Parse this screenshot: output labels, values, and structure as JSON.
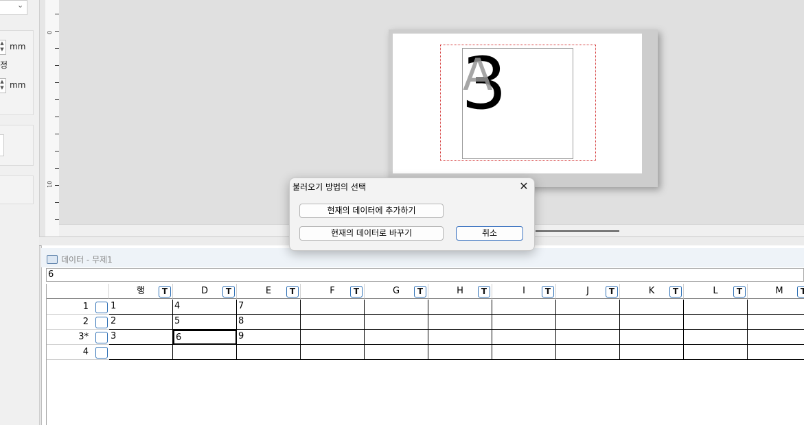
{
  "left_panel": {
    "unit_mm_1": "mm",
    "partial_label": "정",
    "unit_mm_2": "mm",
    "spin_up": "▲",
    "spin_down": "▼",
    "combo_arrow": "⌄"
  },
  "ruler": {
    "labels": [
      "0",
      "10"
    ]
  },
  "canvas": {
    "object_number": "3",
    "object_letter": "A"
  },
  "data_pane": {
    "title": "데이터  - 무제1",
    "formula_value": "6",
    "columns": [
      {
        "label": "행"
      },
      {
        "label": "D"
      },
      {
        "label": "E"
      },
      {
        "label": "F"
      },
      {
        "label": "G"
      },
      {
        "label": "H"
      },
      {
        "label": "I"
      },
      {
        "label": "J"
      },
      {
        "label": "K"
      },
      {
        "label": "L"
      },
      {
        "label": "M"
      }
    ],
    "type_badge": "T",
    "rows": [
      {
        "label": "1",
        "cells": [
          "1",
          "4",
          "7"
        ]
      },
      {
        "label": "2",
        "cells": [
          "2",
          "5",
          "8"
        ]
      },
      {
        "label": "3*",
        "cells": [
          "3",
          "6",
          "9"
        ]
      },
      {
        "label": "4",
        "cells": [
          "",
          "",
          ""
        ]
      }
    ]
  },
  "dialog": {
    "title": "불러오기 방법의 선택",
    "append_button": "현재의 데이터에 추가하기",
    "replace_button": "현재의 데이터로 바꾸기",
    "cancel_button": "취소",
    "close_glyph": "✕"
  }
}
